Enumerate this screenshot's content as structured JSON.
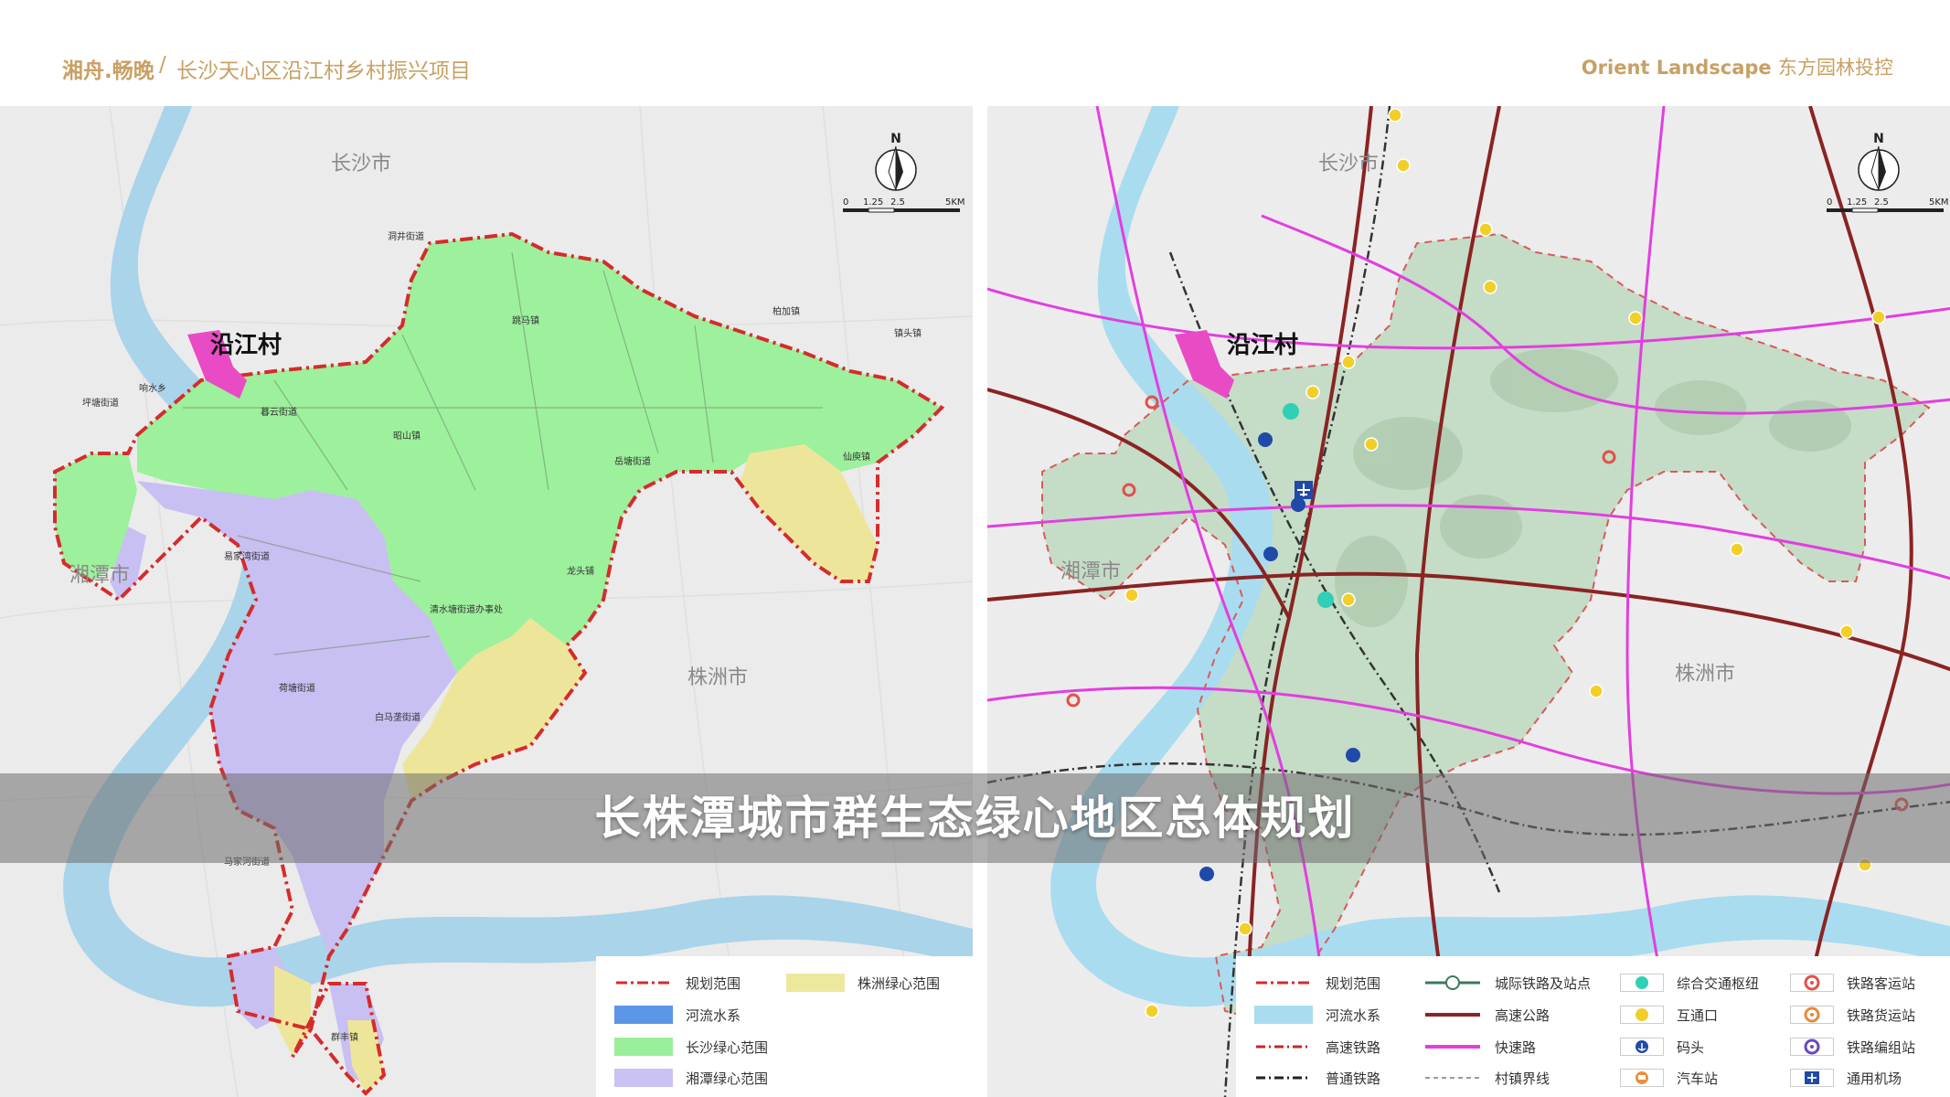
{
  "header": {
    "brand": "湘舟.畅晚",
    "separator": "/",
    "project": "长沙天心区沿江村乡村振兴项目",
    "company_en": "Orient Landscape",
    "company_cn": "东方园林投控"
  },
  "banner": {
    "title": "长株潭城市群生态绿心地区总体规划"
  },
  "map_left": {
    "north": "N",
    "scale": {
      "ticks": [
        "0",
        "1.25",
        "2.5",
        "5KM"
      ]
    },
    "cities": [
      "长沙市",
      "湘潭市",
      "株洲市"
    ],
    "highlight_label": "沿江村",
    "place_labels": [
      "暮云街道",
      "跳马镇",
      "柏加镇",
      "镇头镇",
      "昭山镇",
      "仙庾镇",
      "坪塘街道",
      "响水乡",
      "易家湾街道",
      "荷塘街道",
      "马家河街道",
      "白马垄街道",
      "群丰镇",
      "洞井街道",
      "岳塘街道",
      "龙头铺",
      "清水塘街道办事处"
    ],
    "legend": [
      {
        "label": "规划范围",
        "color": "#d62b2b",
        "style": "dash-dot"
      },
      {
        "label": "株洲绿心范围",
        "color": "#ece99f",
        "style": "fill"
      },
      {
        "label": "河流水系",
        "color": "#5d96e6",
        "style": "fill"
      },
      {
        "label": "长沙绿心范围",
        "color": "#9aef9a",
        "style": "fill"
      },
      {
        "label": "湘潭绿心范围",
        "color": "#c9c2f2",
        "style": "fill"
      }
    ],
    "colors": {
      "changsha": "#9df09c",
      "xiangtan": "#c8bff2",
      "zhuzhou": "#ede69a",
      "water": "#a9d4ea",
      "boundary": "#d62b2b",
      "highlight": "#e94bc5"
    }
  },
  "map_right": {
    "north": "N",
    "scale": {
      "ticks": [
        "0",
        "1.25",
        "2.5",
        "5KM"
      ]
    },
    "cities": [
      "长沙市",
      "湘潭市",
      "株洲市"
    ],
    "highlight_label": "沿江村",
    "legend": [
      {
        "label": "规划范围",
        "icon": "dash-red"
      },
      {
        "label": "城际铁路及站点",
        "icon": "rail-station"
      },
      {
        "label": "综合交通枢纽",
        "icon": "teal-dot"
      },
      {
        "label": "铁路客运站",
        "icon": "red-ring"
      },
      {
        "label": "河流水系",
        "icon": "water"
      },
      {
        "label": "高速公路",
        "icon": "brown-line"
      },
      {
        "label": "互通口",
        "icon": "yellow-dot"
      },
      {
        "label": "铁路货运站",
        "icon": "orange-ring"
      },
      {
        "label": "高速铁路",
        "icon": "rail-red"
      },
      {
        "label": "快速路",
        "icon": "magenta-line"
      },
      {
        "label": "码头",
        "icon": "anchor"
      },
      {
        "label": "铁路编组站",
        "icon": "purple-ring"
      },
      {
        "label": "普通铁路",
        "icon": "rail-black"
      },
      {
        "label": "村镇界线",
        "icon": "dash-gray"
      },
      {
        "label": "汽车站",
        "icon": "bus"
      },
      {
        "label": "通用机场",
        "icon": "plane"
      }
    ],
    "colors": {
      "highway": "#8b2323",
      "expressway": "#e23ee0",
      "railway": "#333333",
      "water": "#a9dcef",
      "green": "#c5dcc6",
      "interchange": "#f2cf28",
      "hub": "#2fd0b5"
    }
  }
}
